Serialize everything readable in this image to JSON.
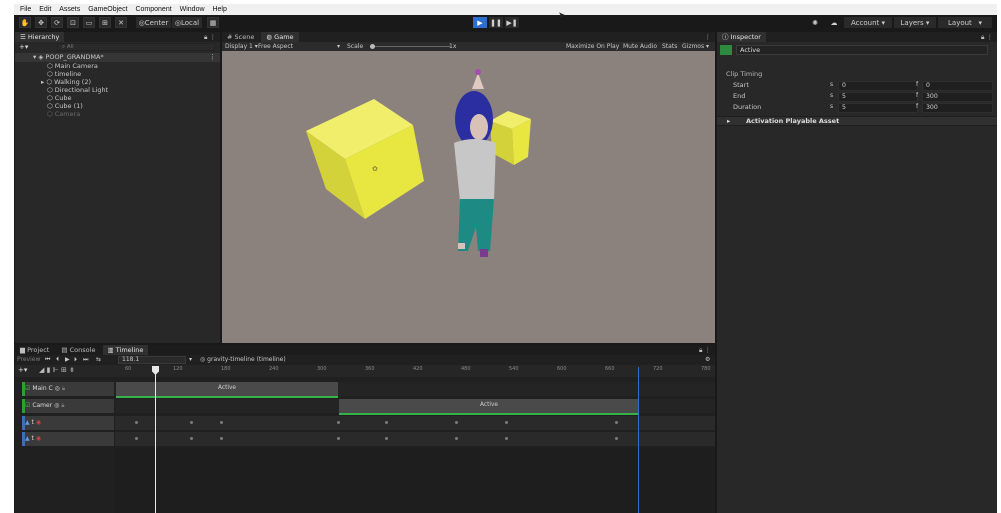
{
  "menu": {
    "items": [
      "File",
      "Edit",
      "Assets",
      "GameObject",
      "Component",
      "Window",
      "Help"
    ]
  },
  "toolbar": {
    "pivot_label": "Center",
    "space_label": "Local",
    "account_label": "Account",
    "layers_label": "Layers",
    "layout_label": "Layout"
  },
  "hierarchy": {
    "tab": "Hierarchy",
    "search_placeholder": "All",
    "scene_name": "POOP_GRANDMA*",
    "items": [
      "Main Camera",
      "timeline",
      "Walking (2)",
      "Directional Light",
      "Cube",
      "Cube (1)",
      "Camera"
    ]
  },
  "view_tabs": {
    "scene": "Scene",
    "game": "Game"
  },
  "game_toolbar": {
    "display": "Display 1",
    "aspect": "Free Aspect",
    "scale_label": "Scale",
    "scale_value": "1x",
    "maximize": "Maximize On Play",
    "mute": "Mute Audio",
    "stats": "Stats",
    "gizmos": "Gizmos"
  },
  "inspector": {
    "tab": "Inspector",
    "title": "Active",
    "section": "Clip Timing",
    "rows": [
      {
        "label": "Start",
        "s": "0",
        "f": "0"
      },
      {
        "label": "End",
        "s": "5",
        "f": "300"
      },
      {
        "label": "Duration",
        "s": "5",
        "f": "300"
      }
    ],
    "s_prefix": "s",
    "f_prefix": "f",
    "asset_section": "Activation Playable Asset"
  },
  "bottom_tabs": {
    "project": "Project",
    "console": "Console",
    "timeline": "Timeline"
  },
  "timeline": {
    "preview": "Preview",
    "frame": "118.1",
    "asset": "gravity-timeline (timeline)",
    "ruler": [
      "60",
      "120",
      "180",
      "240",
      "300",
      "360",
      "420",
      "480",
      "540",
      "600",
      "660",
      "720",
      "780"
    ],
    "tracks": [
      {
        "name": "Main C",
        "clip": "Active"
      },
      {
        "name": "Camer",
        "clip": "Active"
      }
    ],
    "anim_tracks": [
      "t",
      "t"
    ]
  },
  "colors": {
    "accent": "#2d6fcf",
    "track_green": "#36b24a",
    "game_bg": "#8c827d",
    "cube": "#e8e640"
  }
}
